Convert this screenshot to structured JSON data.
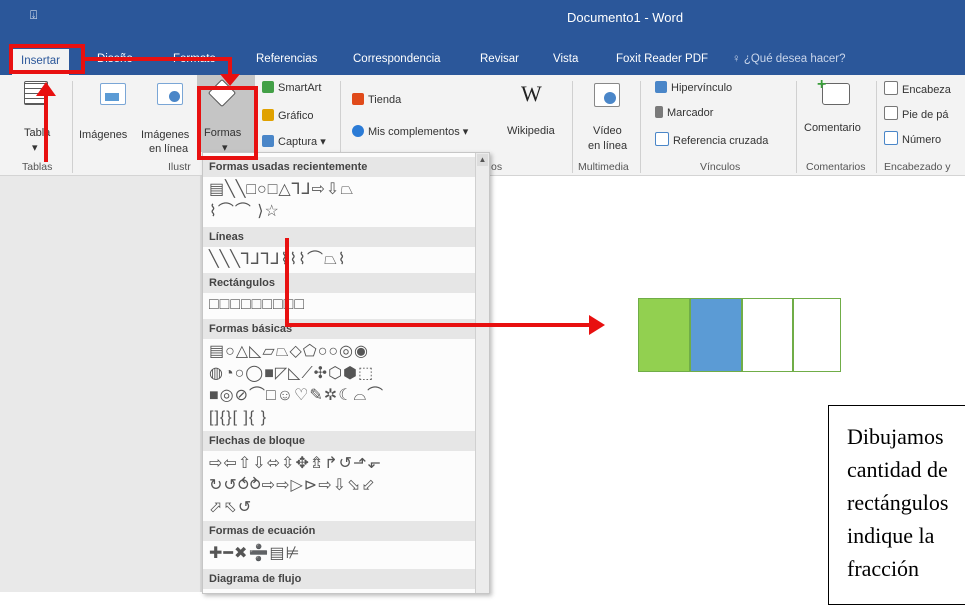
{
  "window": {
    "title": "Documento1 - Word",
    "qat_icon": "quick-access-arrow"
  },
  "tabs": [
    "Insertar",
    "Diseño",
    "Formato",
    "Referencias",
    "Correspondencia",
    "Revisar",
    "Vista",
    "Foxit Reader PDF"
  ],
  "tell_me": {
    "label": "¿Qué desea hacer?",
    "icon": "lightbulb-icon"
  },
  "ribbon": {
    "tabla": {
      "line1": "Tabla",
      "arrow": "▾"
    },
    "imagenes": "Imágenes",
    "imagenes_en_linea": [
      "Imágenes",
      "en línea"
    ],
    "formas": {
      "label": "Formas",
      "arrow": "▾"
    },
    "smartart": "SmartArt",
    "grafico": "Gráfico",
    "captura": "Captura",
    "captura_arrow": "▾",
    "tienda": "Tienda",
    "mis_complementos": "Mis complementos",
    "mis_complementos_arrow": "▾",
    "wikipedia": "Wikipedia",
    "wikipedia_glyph": "W",
    "video": [
      "Vídeo",
      "en línea"
    ],
    "hipervinculo": "Hipervínculo",
    "marcador": "Marcador",
    "referencia_cruzada": "Referencia cruzada",
    "comentario": "Comentario",
    "encabezado": "Encabeza",
    "pie_de_pagina": "Pie de pá",
    "numero": "Número"
  },
  "group_labels": {
    "tablas": "Tablas",
    "ilustraciones": "Ilustr",
    "complementos": "os",
    "multimedia": "Multimedia",
    "vinculos": "Vínculos",
    "comentarios": "Comentarios",
    "encabezado": "Encabezado y"
  },
  "shapes_menu": {
    "sections": [
      {
        "title": "Formas usadas recientemente",
        "rows": [
          "▤╲╲□○□△⅂⅃⇨⇩⏢",
          "⌇⌒⌒  ⟩☆"
        ]
      },
      {
        "title": "Líneas",
        "rows": [
          "╲╲╲⅂⅃⅂⅃⌇⌇⌇⌒⏢⌇"
        ]
      },
      {
        "title": "Rectángulos",
        "rows": [
          "□□□□□□□□□"
        ]
      },
      {
        "title": "Formas básicas",
        "rows": [
          "▤○△◺▱⏢◇⬠○○◎◉",
          "◍◔○◯■◸◺⟋✣⬡⬢⬚",
          "■◎⊘⌒□☺♡✎✲☾⌓⌒",
          "[]{}[ ]{ }"
        ]
      },
      {
        "title": "Flechas de bloque",
        "rows": [
          "⇨⇦⇧⇩⬄⇳✥⇯↱↺⬏⬐",
          "↻↺⥀⥁⇨⇨▷⊳⇨⇩⬂⬃",
          "⬀⬁↺"
        ]
      },
      {
        "title": "Formas de ecuación",
        "rows": [
          "✚━✖➗▤⊭"
        ]
      },
      {
        "title": "Diagrama de flujo",
        "rows": []
      }
    ]
  },
  "document": {
    "fraction_parts": [
      {
        "fill": "#92d050"
      },
      {
        "fill": "#5b9bd5"
      },
      {
        "fill": "#ffffff"
      },
      {
        "fill": "#ffffff"
      }
    ],
    "textbox_lines": [
      "Dibujamos",
      "cantidad de",
      "rectángulos",
      "indique la",
      "fracción"
    ]
  },
  "colors": {
    "ribbon_blue": "#2b579a",
    "highlight_red": "#e81010",
    "shape_green": "#92d050",
    "shape_blue": "#5b9bd5",
    "shape_border": "#70ad47"
  }
}
